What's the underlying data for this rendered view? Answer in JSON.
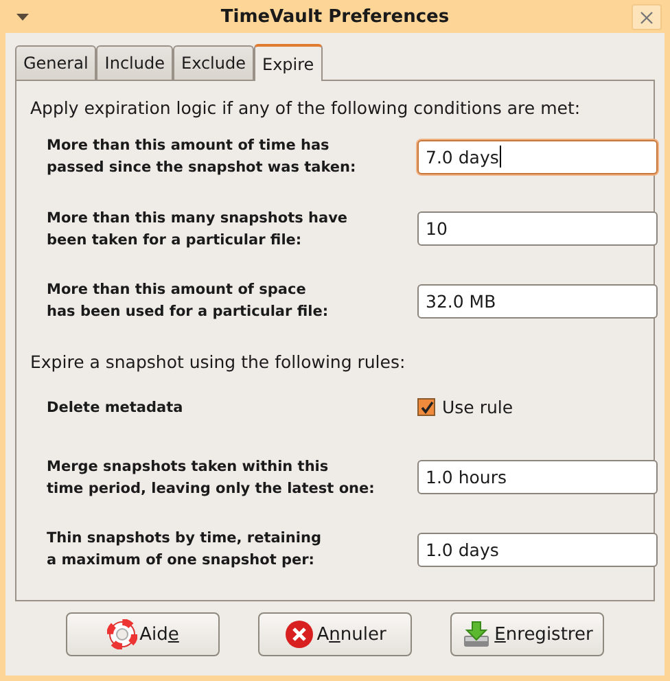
{
  "window": {
    "title": "TimeVault Preferences"
  },
  "tabs": [
    {
      "label": "General",
      "selected": false
    },
    {
      "label": "Include",
      "selected": false
    },
    {
      "label": "Exclude",
      "selected": false
    },
    {
      "label": "Expire",
      "selected": true
    }
  ],
  "sections": [
    {
      "heading": "Apply expiration logic if any of the following conditions are met:",
      "rows": [
        {
          "kind": "text",
          "label": "More than this amount of time has\npassed since the snapshot was taken:",
          "value": "7.0 days",
          "focused": true
        },
        {
          "kind": "text",
          "label": "More than this many snapshots have\nbeen taken for a particular file:",
          "value": "10",
          "focused": false
        },
        {
          "kind": "text",
          "label": "More than this amount of space\nhas been used for a particular file:",
          "value": "32.0 MB",
          "focused": false
        }
      ]
    },
    {
      "heading": "Expire a snapshot using the following rules:",
      "rows": [
        {
          "kind": "check",
          "label": "Delete metadata",
          "option": "Use rule",
          "checked": true
        },
        {
          "kind": "text",
          "label": "Merge snapshots taken within this\ntime period, leaving only the latest one:",
          "value": "1.0 hours",
          "focused": false
        },
        {
          "kind": "text",
          "label": "Thin snapshots by time, retaining\na maximum of one snapshot per:",
          "value": "1.0 days",
          "focused": false
        }
      ]
    }
  ],
  "buttons": [
    {
      "kind": "help",
      "label_before": "Aid",
      "mnemonic": "e"
    },
    {
      "kind": "cancel",
      "label_before": "A",
      "mnemonic": "n",
      "label_after": "nuler"
    },
    {
      "kind": "save",
      "mnemonic": "E",
      "label_after": "nregistrer"
    }
  ]
}
